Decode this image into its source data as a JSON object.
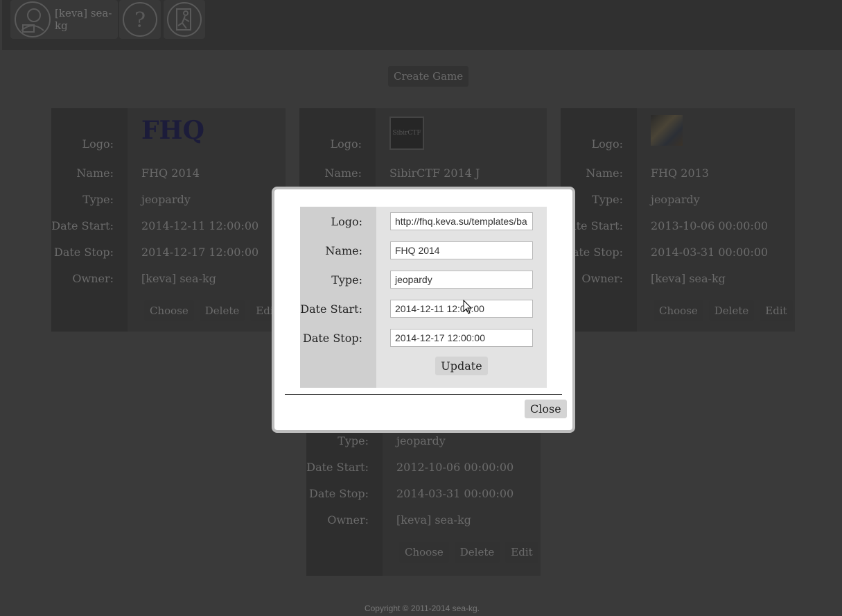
{
  "header": {
    "user_label": "[keva] sea-kg",
    "icons": [
      "user-avatar-icon",
      "help-icon",
      "logout-icon"
    ]
  },
  "toolbar": {
    "create_game_label": "Create Game"
  },
  "labels": {
    "logo": "Logo:",
    "name": "Name:",
    "type": "Type:",
    "date_start": "Date Start:",
    "date_stop": "Date Stop:",
    "owner": "Owner:"
  },
  "actions": {
    "choose": "Choose",
    "delete": "Delete",
    "edit": "Edit"
  },
  "games": [
    {
      "logo_text": "FHQ",
      "name": "FHQ 2014",
      "type": "jeopardy",
      "date_start": "2014-12-11 12:00:00",
      "date_stop": "2014-12-17 12:00:00",
      "owner": "[keva] sea-kg"
    },
    {
      "logo_text": "SibirCTF",
      "name": "SibirCTF 2014 J"
    },
    {
      "name": "FHQ 2013",
      "type": "jeopardy",
      "date_start": "2013-10-06 00:00:00",
      "date_stop": "2014-03-31 00:00:00",
      "owner": "[keva] sea-kg"
    },
    {
      "type": "jeopardy",
      "date_start": "2012-10-06 00:00:00",
      "date_stop": "2014-03-31 00:00:00",
      "owner": "[keva] sea-kg"
    }
  ],
  "modal": {
    "labels": {
      "logo": "Logo:",
      "name": "Name:",
      "type": "Type:",
      "date_start": "Date Start:",
      "date_stop": "Date Stop:"
    },
    "fields": {
      "logo": "http://fhq.keva.su/templates/ba",
      "name": "FHQ 2014",
      "type": "jeopardy",
      "date_start": "2014-12-11 12:00:00",
      "date_stop": "2014-12-17 12:00:00"
    },
    "update_label": "Update",
    "close_label": "Close"
  },
  "footer": {
    "copyright": "Copyright © 2011-2014 sea-kg."
  }
}
